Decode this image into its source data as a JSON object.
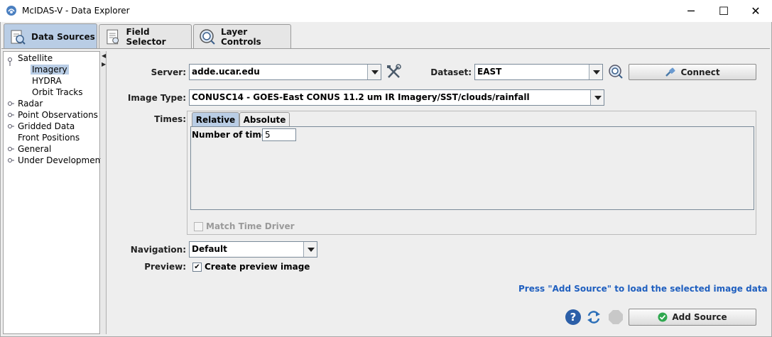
{
  "window": {
    "title": "McIDAS-V - Data Explorer",
    "controls": {
      "minimize": "─",
      "maximize": "☐",
      "close": "✕"
    }
  },
  "tabs": [
    {
      "label": "Data Sources",
      "icon": "data-sources-icon",
      "active": true
    },
    {
      "label": "Field Selector",
      "icon": "field-selector-icon",
      "active": false
    },
    {
      "label": "Layer Controls",
      "icon": "layer-controls-icon",
      "active": false
    }
  ],
  "tree": {
    "items": [
      {
        "label": "Satellite",
        "expanded": true
      },
      {
        "label": "Imagery",
        "selected": true
      },
      {
        "label": "HYDRA"
      },
      {
        "label": "Orbit Tracks"
      },
      {
        "label": "Radar"
      },
      {
        "label": "Point Observations"
      },
      {
        "label": "Gridded Data"
      },
      {
        "label": "Front Positions"
      },
      {
        "label": "General"
      },
      {
        "label": "Under Development"
      }
    ]
  },
  "form": {
    "server": {
      "label": "Server:",
      "value": "adde.ucar.edu"
    },
    "dataset": {
      "label": "Dataset:",
      "value": "EAST"
    },
    "connect_label": "Connect",
    "image_type": {
      "label": "Image Type:",
      "value": "CONUSC14 - GOES-East CONUS 11.2 um IR Imagery/SST/clouds/rainfall"
    },
    "times": {
      "label": "Times:",
      "tabs": [
        "Relative",
        "Absolute"
      ],
      "active_tab": "Relative",
      "number_label": "Number of times:",
      "number_value": "5",
      "match_time_driver": {
        "label": "Match Time Driver",
        "checked": false,
        "enabled": false
      }
    },
    "navigation": {
      "label": "Navigation:",
      "value": "Default"
    },
    "preview": {
      "label": "Preview:",
      "checkbox_label": "Create preview image",
      "checked": true
    }
  },
  "hint": "Press \"Add Source\" to load the selected image data",
  "footer": {
    "add_source_label": "Add Source",
    "help": "?"
  },
  "colors": {
    "active_tab": "#b9cde5",
    "hint_text": "#1f5fbf",
    "add_icon": "#2fa84f",
    "help_icon": "#2c5fa8"
  }
}
